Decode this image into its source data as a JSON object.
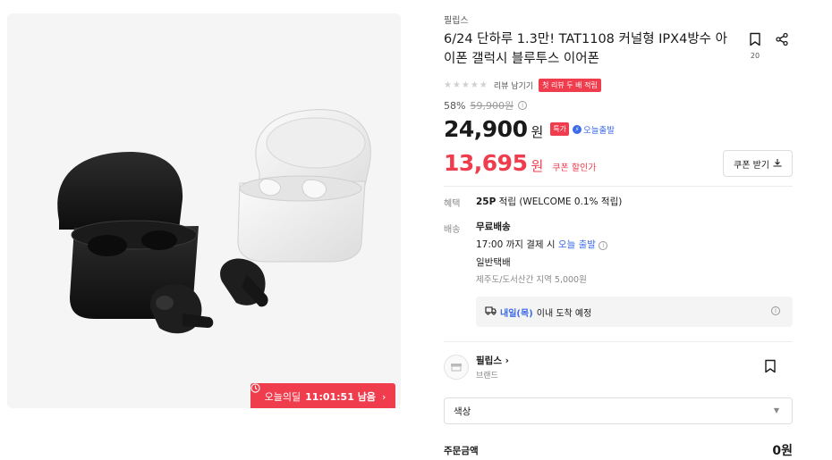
{
  "product": {
    "brand": "필립스",
    "title": "6/24 단하루 1.3만! TAT1108 커널형 IPX4방수 아이폰 갤럭시 블루투스 이어폰",
    "bookmark_count": "20",
    "review_link": "리뷰 남기기",
    "review_badge": "첫 리뷰 두 배 적립",
    "discount_rate": "58%",
    "original_price": "59,900원",
    "price": "24,900",
    "price_unit": "원",
    "special_badge": "특가",
    "today_ship_badge": "오늘출발",
    "coupon_price": "13,695",
    "coupon_unit": "원",
    "coupon_label": "쿠폰 할인가",
    "coupon_button": "쿠폰 받기"
  },
  "deal": {
    "label": "오늘의딜",
    "timer": "11:01:51 남음"
  },
  "benefit": {
    "label": "혜택",
    "points": "25P",
    "text": "적립 (WELCOME 0.1% 적립)"
  },
  "shipping": {
    "label": "배송",
    "type": "무료배송",
    "cutoff_pre": "17:00 까지 결제 시",
    "cutoff_highlight": "오늘 출발",
    "method": "일반택배",
    "remote": "제주도/도서산간 지역 5,000원",
    "arrival_highlight": "내일(목)",
    "arrival_text": "이내 도착 예정"
  },
  "store": {
    "name": "필립스",
    "type": "브랜드"
  },
  "option": {
    "placeholder": "색상"
  },
  "order": {
    "total_label": "주문금액",
    "total_value": "0원"
  },
  "colors": {
    "accent_red": "#ef3d4d",
    "accent_blue": "#3d6ae8"
  },
  "icons": [
    "bookmark-icon",
    "share-icon",
    "star-icon",
    "info-icon",
    "clock-icon",
    "download-icon",
    "truck-icon",
    "chevron-down-icon",
    "chevron-right-icon"
  ]
}
